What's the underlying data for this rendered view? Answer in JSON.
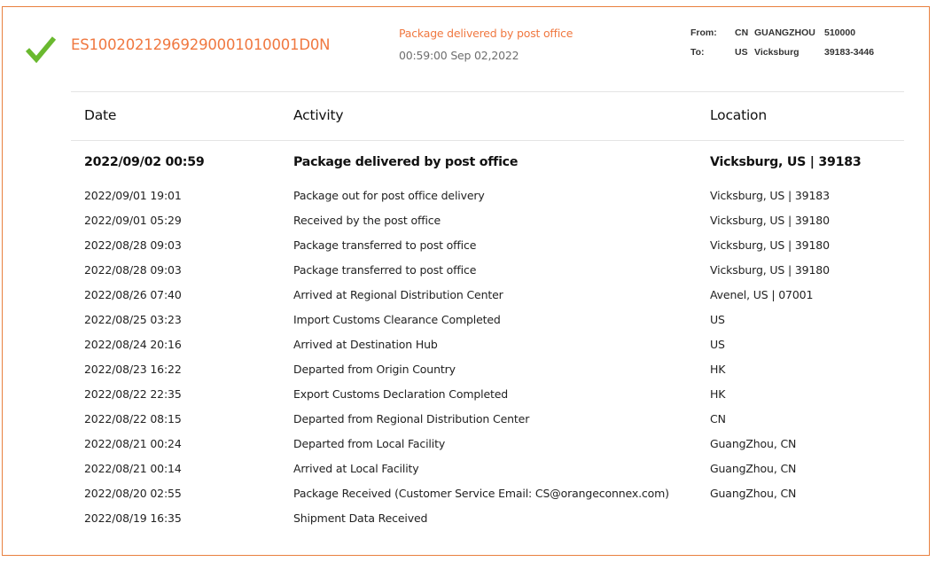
{
  "shipment": {
    "status_icon": "checkmark-icon",
    "status_color": "#6ab92f",
    "accent_color": "#f07840",
    "tracking_number": "ES10020212969290001010001D0N",
    "latest_status": "Package delivered by post office",
    "latest_time": "00:59:00 Sep 02,2022"
  },
  "route": {
    "from": {
      "label": "From:",
      "country": "CN",
      "city": "GUANGZHOU",
      "postal": "510000"
    },
    "to": {
      "label": "To:",
      "country": "US",
      "city": "Vicksburg",
      "postal": "39183-3446"
    }
  },
  "table": {
    "headers": {
      "date": "Date",
      "activity": "Activity",
      "location": "Location"
    },
    "rows": [
      {
        "date": "2022/09/02 00:59",
        "activity": "Package delivered by post office",
        "location": "Vicksburg, US | 39183"
      },
      {
        "date": "2022/09/01 19:01",
        "activity": "Package out for post office delivery",
        "location": "Vicksburg, US | 39183"
      },
      {
        "date": "2022/09/01 05:29",
        "activity": "Received by the post office",
        "location": "Vicksburg, US | 39180"
      },
      {
        "date": "2022/08/28 09:03",
        "activity": "Package transferred to post office",
        "location": "Vicksburg, US | 39180"
      },
      {
        "date": "2022/08/28 09:03",
        "activity": "Package transferred to post office",
        "location": "Vicksburg, US | 39180"
      },
      {
        "date": "2022/08/26 07:40",
        "activity": "Arrived at Regional Distribution Center",
        "location": "Avenel, US | 07001"
      },
      {
        "date": "2022/08/25 03:23",
        "activity": "Import Customs Clearance Completed",
        "location": "US"
      },
      {
        "date": "2022/08/24 20:16",
        "activity": "Arrived at Destination Hub",
        "location": "US"
      },
      {
        "date": "2022/08/23 16:22",
        "activity": "Departed from Origin Country",
        "location": "HK"
      },
      {
        "date": "2022/08/22 22:35",
        "activity": "Export Customs Declaration Completed",
        "location": "HK"
      },
      {
        "date": "2022/08/22 08:15",
        "activity": "Departed from Regional Distribution Center",
        "location": "CN"
      },
      {
        "date": "2022/08/21 00:24",
        "activity": "Departed from Local Facility",
        "location": "GuangZhou, CN"
      },
      {
        "date": "2022/08/21 00:14",
        "activity": "Arrived at Local Facility",
        "location": "GuangZhou, CN"
      },
      {
        "date": "2022/08/20 02:55",
        "activity": "Package Received (Customer Service Email: CS@orangeconnex.com)",
        "location": "GuangZhou, CN"
      },
      {
        "date": "2022/08/19 16:35",
        "activity": "Shipment Data Received",
        "location": ""
      }
    ]
  }
}
